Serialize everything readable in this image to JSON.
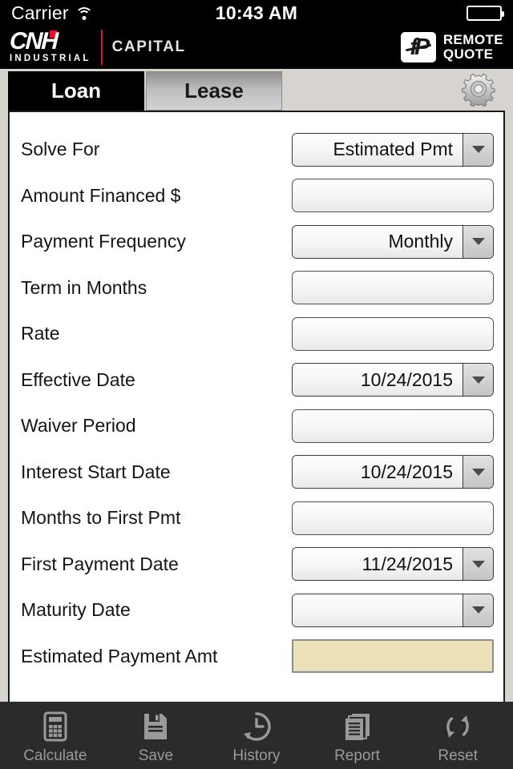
{
  "statusbar": {
    "carrier": "Carrier",
    "time": "10:43 AM",
    "wifi_icon": "wifi-icon",
    "battery_icon": "battery-full-icon"
  },
  "header": {
    "logo_letters": "CNH",
    "logo_sub": "INDUSTRIAL",
    "logo_secondary": "CAPITAL",
    "app_badge": "fP",
    "app_name_line1": "REMOTE",
    "app_name_line2": "QUOTE"
  },
  "tabs": [
    {
      "label": "Loan",
      "active": true
    },
    {
      "label": "Lease",
      "active": false
    }
  ],
  "settings_button": {
    "icon": "gear-icon"
  },
  "form": {
    "rows": [
      {
        "label": "Solve For",
        "type": "dropdown",
        "value": "Estimated Pmt"
      },
      {
        "label": "Amount Financed $",
        "type": "input",
        "value": ""
      },
      {
        "label": "Payment Frequency",
        "type": "dropdown",
        "value": "Monthly"
      },
      {
        "label": "Term in Months",
        "type": "input",
        "value": ""
      },
      {
        "label": "Rate",
        "type": "input",
        "value": ""
      },
      {
        "label": "Effective Date",
        "type": "dropdown",
        "value": "10/24/2015"
      },
      {
        "label": "Waiver Period",
        "type": "input",
        "value": ""
      },
      {
        "label": "Interest Start Date",
        "type": "dropdown",
        "value": "10/24/2015"
      },
      {
        "label": "Months to First Pmt",
        "type": "input",
        "value": ""
      },
      {
        "label": "First Payment Date",
        "type": "dropdown",
        "value": "11/24/2015"
      },
      {
        "label": "Maturity Date",
        "type": "dropdown",
        "value": ""
      },
      {
        "label": "Estimated Payment Amt",
        "type": "result",
        "value": ""
      }
    ]
  },
  "toolbar": {
    "items": [
      {
        "label": "Calculate",
        "icon": "calculator-icon"
      },
      {
        "label": "Save",
        "icon": "floppy-disk-icon"
      },
      {
        "label": "History",
        "icon": "clock-history-icon"
      },
      {
        "label": "Report",
        "icon": "documents-icon"
      },
      {
        "label": "Reset",
        "icon": "refresh-icon"
      }
    ]
  },
  "colors": {
    "accent_red": "#e8112d",
    "result_field": "#ece0b8",
    "toolbar_bg": "#2b2b2b",
    "page_bg": "#d7d4cf"
  }
}
